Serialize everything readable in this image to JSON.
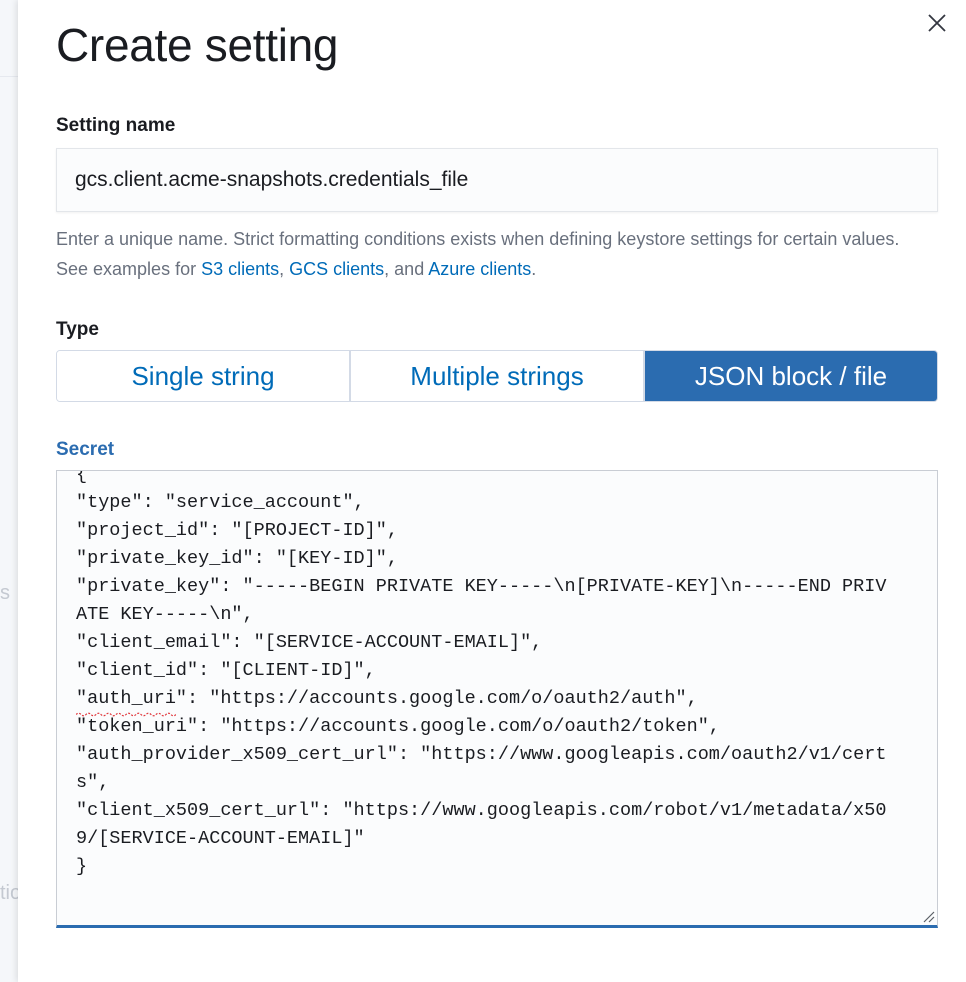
{
  "background_fragments": [
    "s",
    "tio"
  ],
  "flyout": {
    "title": "Create setting",
    "close_icon": "close-icon"
  },
  "setting_name": {
    "label": "Setting name",
    "value": "gcs.client.acme-snapshots.credentials_file",
    "help_text_before": "Enter a unique name. Strict formatting conditions exists when defining keystore settings for certain values. See examples for ",
    "links": [
      "S3 clients",
      "GCS clients",
      "Azure clients"
    ],
    "help_sep_1": ", ",
    "help_sep_2": ", and ",
    "help_end": "."
  },
  "type": {
    "label": "Type",
    "options": [
      "Single string",
      "Multiple strings",
      "JSON block / file"
    ],
    "selected": "JSON block / file"
  },
  "secret": {
    "label": "Secret",
    "value": "{\n\"type\": \"service_account\",\n\"project_id\": \"[PROJECT-ID]\",\n\"private_key_id\": \"[KEY-ID]\",\n\"private_key\": \"-----BEGIN PRIVATE KEY-----\\n[PRIVATE-KEY]\\n-----END PRIVATE KEY-----\\n\",\n\"client_email\": \"[SERVICE-ACCOUNT-EMAIL]\",\n\"client_id\": \"[CLIENT-ID]\",\n\"auth_uri\": \"https://accounts.google.com/o/oauth2/auth\",\n\"token_uri\": \"https://accounts.google.com/o/oauth2/token\",\n\"auth_provider_x509_cert_url\": \"https://www.googleapis.com/oauth2/v1/certs\",\n\"client_x509_cert_url\": \"https://www.googleapis.com/robot/v1/metadata/x509/[SERVICE-ACCOUNT-EMAIL]\"\n}"
  },
  "colors": {
    "primary": "#2b6cb0",
    "link": "#006bb8",
    "text": "#1a1c21",
    "subdued": "#69707d"
  }
}
